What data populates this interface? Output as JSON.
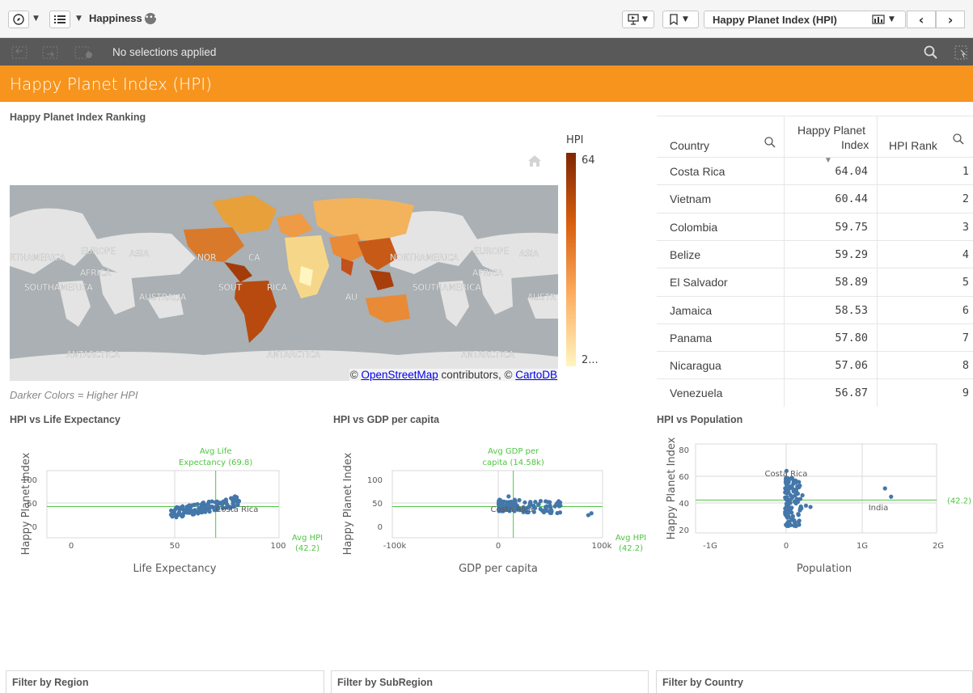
{
  "toolbar": {
    "app_name": "Happiness",
    "sheet_selector_label": "Happy Planet Index (HPI)"
  },
  "selection_bar": {
    "status": "No selections applied"
  },
  "sheet": {
    "title": "Happy Planet Index (HPI)"
  },
  "map_panel": {
    "title": "Happy Planet Index Ranking",
    "legend_title": "HPI",
    "legend_max": "64",
    "legend_min": "2...",
    "footnote": "Darker Colors = Higher HPI",
    "attribution_prefix": "© ",
    "attribution_osm": "OpenStreetMap",
    "attribution_mid": " contributors, © ",
    "attribution_carto": "CartoDB",
    "continent_labels": [
      "EUROPE",
      "ASIA",
      "RTHAMERICA",
      "AFRICA",
      "SOUTHAMERICA",
      "AUSTRALIA",
      "NOR",
      "CA",
      "SOUT",
      "RICA",
      "AU",
      "NORTHAMERICA",
      "EUROPE",
      "ASIA",
      "AFRICA",
      "SOUTHAMERICA",
      "AUSTR",
      "ANTARCTICA",
      "ANTARCTICA",
      "ANTARCTICA"
    ],
    "colors": {
      "high": "#7f2704",
      "low": "#fff5c0",
      "ocean": "#aab0b3",
      "land": "#e4e4e4"
    }
  },
  "ranking_table": {
    "headers": {
      "country": "Country",
      "hpi_line1": "Happy Planet",
      "hpi_line2": "Index",
      "rank": "HPI Rank"
    },
    "rows": [
      {
        "country": "Costa Rica",
        "hpi": "64.04",
        "rank": "1"
      },
      {
        "country": "Vietnam",
        "hpi": "60.44",
        "rank": "2"
      },
      {
        "country": "Colombia",
        "hpi": "59.75",
        "rank": "3"
      },
      {
        "country": "Belize",
        "hpi": "59.29",
        "rank": "4"
      },
      {
        "country": "El Salvador",
        "hpi": "58.89",
        "rank": "5"
      },
      {
        "country": "Jamaica",
        "hpi": "58.53",
        "rank": "6"
      },
      {
        "country": "Panama",
        "hpi": "57.80",
        "rank": "7"
      },
      {
        "country": "Nicaragua",
        "hpi": "57.06",
        "rank": "8"
      },
      {
        "country": "Venezuela",
        "hpi": "56.87",
        "rank": "9"
      }
    ]
  },
  "filters": {
    "region": "Filter by Region",
    "subregion": "Filter by SubRegion",
    "country": "Filter by Country"
  },
  "chart_data": [
    {
      "type": "scatter",
      "title": "HPI vs Life Expectancy",
      "xlabel": "Life Expectancy",
      "ylabel": "Happy Planet Index",
      "xlim": [
        -10,
        100
      ],
      "ylim": [
        0,
        110
      ],
      "xticks": [
        "0",
        "50",
        "100"
      ],
      "yticks": [
        "0",
        "50",
        "100"
      ],
      "ref_lines": {
        "x_label_1": "Avg Life",
        "x_label_2": "Expectancy (69.8)",
        "x": 69.8,
        "y_label_1": "Avg HPI",
        "y_label_2": "(42.2)",
        "y": 42.2
      },
      "annotation": {
        "text": "Costa Rica",
        "x": 79.1,
        "y": 64.04
      },
      "color": "#4477aa"
    },
    {
      "type": "scatter",
      "title": "HPI vs GDP per capita",
      "xlabel": "GDP per capita",
      "ylabel": "Happy Planet Index",
      "xlim": [
        -100000,
        100000
      ],
      "ylim": [
        0,
        110
      ],
      "xticks": [
        "-100k",
        "0",
        "100k"
      ],
      "yticks": [
        "0",
        "50",
        "100"
      ],
      "ref_lines": {
        "x_label_1": "Avg GDP per",
        "x_label_2": "capita (14.58k)",
        "x": 14580,
        "y_label_1": "Avg HPI",
        "y_label_2": "(42.2)",
        "y": 42.2
      },
      "annotation": {
        "text": "Costa Rica",
        "x": 10000,
        "y": 64.04
      },
      "color": "#4477aa"
    },
    {
      "type": "scatter",
      "title": "HPI vs Population",
      "xlabel": "Population",
      "ylabel": "Happy Planet Index",
      "xlim": [
        -1000000000,
        2000000000
      ],
      "ylim": [
        20,
        80
      ],
      "xticks": [
        "-1G",
        "0",
        "1G",
        "2G"
      ],
      "yticks": [
        "20",
        "40",
        "60",
        "80"
      ],
      "ref_lines": {
        "y_label": "(42.2)",
        "y": 42.2
      },
      "annotations": [
        {
          "text": "Costa Rica",
          "x": 4800000,
          "y": 64.04
        },
        {
          "text": "India",
          "x": 1300000000,
          "y": 50.9
        }
      ],
      "color": "#4477aa"
    }
  ]
}
